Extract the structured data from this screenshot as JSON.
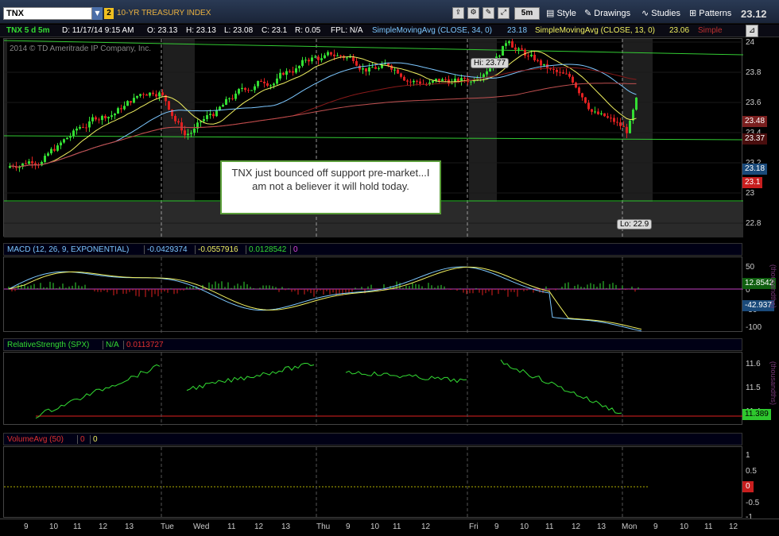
{
  "toolbar": {
    "symbol": "TNX",
    "link_badge": "2",
    "description": "10-YR TREASURY INDEX",
    "period": "5m",
    "style_label": "Style",
    "drawings_label": "Drawings",
    "studies_label": "Studies",
    "patterns_label": "Patterns",
    "last_price": "23.12"
  },
  "status": {
    "chart_id": "TNX 5 d 5m",
    "date": "D: 11/17/14 9:15 AM",
    "open": "O: 23.13",
    "high": "H: 23.13",
    "low": "L: 23.08",
    "close": "C: 23.1",
    "range": "R: 0.05",
    "fpl": "FPL: N/A",
    "sma1_label": "SimpleMovingAvg (CLOSE, 34, 0)",
    "sma1_value": "23.18",
    "sma2_label": "SimpleMovingAvg (CLOSE, 13, 0)",
    "sma2_value": "23.06",
    "sma3_label": "Simple",
    "colors": {
      "sma34": "#7cc7ff",
      "sma13": "#f0f060",
      "close": "#ffffff"
    }
  },
  "price_panel": {
    "watermark": "2014 © TD Ameritrade IP Company, Inc.",
    "hi_label": "Hi: 23.77",
    "lo_label": "Lo: 22.9",
    "axis_ticks": [
      "24",
      "23.8",
      "23.6",
      "23.4",
      "23.2",
      "23",
      "22.8"
    ],
    "price_tags": [
      {
        "label": "23.48",
        "color": "#7a1f1f"
      },
      {
        "label": "23.37",
        "color": "#4a0e0e"
      },
      {
        "label": "23.18",
        "color": "#1a4a7a"
      },
      {
        "label": "23.1",
        "color": "#c81e1e"
      }
    ]
  },
  "annotation": {
    "text": "TNX just bounced off support pre-market...I am not a believer it will hold today."
  },
  "macd_panel": {
    "label": "MACD (12, 26, 9, EXPONENTIAL)",
    "value1": "-0.0429374",
    "value2": "-0.0557916",
    "value3": "0.0128542",
    "value4": "0",
    "axis_ticks": [
      "50",
      "0",
      "-50",
      "-100"
    ],
    "side_label": "(thousandths)",
    "tags": [
      {
        "label": "12.8542",
        "color": "#0f5f0f"
      },
      {
        "label": "-42.937",
        "color": "#1a4a7a"
      }
    ]
  },
  "rs_panel": {
    "label": "RelativeStrength (SPX)",
    "value1": "N/A",
    "value2": "0.0113727",
    "axis_ticks": [
      "11.6",
      "11.5",
      "11.4"
    ],
    "side_label": "(thousandths)",
    "tag": "11.389"
  },
  "volume_panel": {
    "label": "VolumeAvg (50)",
    "value1": "0",
    "value2": "0",
    "axis_ticks": [
      "1",
      "0.5",
      "0",
      "-0.5",
      "-1"
    ],
    "tag": "0"
  },
  "time_axis": {
    "labels": [
      "9",
      "10",
      "11",
      "12",
      "13",
      "Tue",
      "Wed",
      "11",
      "12",
      "13",
      "Thu",
      "9",
      "10",
      "11",
      "12",
      "Fri",
      "9",
      "10",
      "11",
      "12",
      "13",
      "Mon",
      "9",
      "10",
      "11",
      "12"
    ]
  }
}
